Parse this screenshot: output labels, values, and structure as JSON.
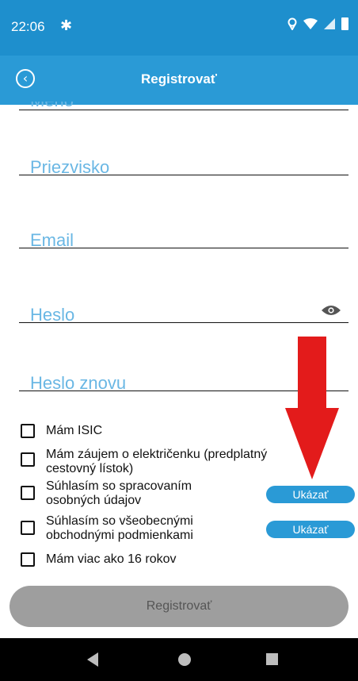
{
  "status_bar": {
    "time": "22:06",
    "gear_icon": "gear-icon",
    "location_icon": "location-icon",
    "wifi_icon": "wifi-icon",
    "signal_icon": "signal-icon",
    "battery_icon": "battery-icon"
  },
  "app_bar": {
    "title": "Registrovať",
    "back_icon": "back-circle-icon"
  },
  "form": {
    "partial_field_label": "Meno",
    "surname_label": "Priezvisko",
    "email_label": "Email",
    "password_label": "Heslo",
    "password_repeat_label": "Heslo znovu",
    "eye_icon": "eye-icon"
  },
  "checkboxes": [
    {
      "line1": "Mám ISIC",
      "line2": ""
    },
    {
      "line1": "Mám záujem o električenku (predplatný",
      "line2": "cestovný lístok)"
    },
    {
      "line1": "Súhlasím so spracovaním",
      "line2": "osobných údajov"
    },
    {
      "line1": "Súhlasím so všeobecnými",
      "line2": "obchodnými podmienkami"
    },
    {
      "line1": "Mám viac ako 16 rokov",
      "line2": ""
    }
  ],
  "show_buttons": {
    "label_1": "Ukázať",
    "label_2": "Ukázať"
  },
  "register_button": {
    "label": "Registrovať"
  },
  "colors": {
    "header": "#1e8fcd",
    "accent": "#2a9ad6",
    "label": "#6ab7e4",
    "arrow": "#e31b1b",
    "disabled": "#9e9e9e"
  }
}
